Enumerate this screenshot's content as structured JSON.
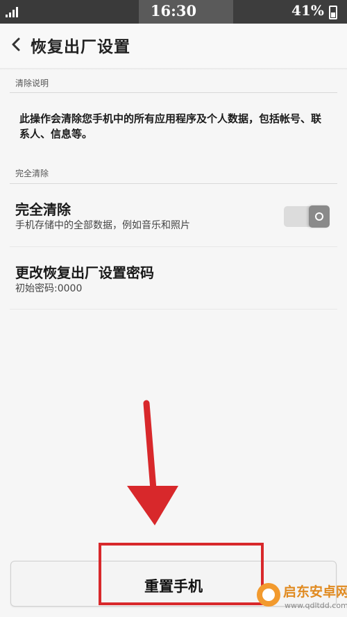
{
  "status_bar": {
    "time": "16:30",
    "battery_percent": "41%",
    "battery_level": 0.41,
    "signal_icon": "signal-bars-icon",
    "battery_icon": "battery-icon"
  },
  "header": {
    "back_icon": "chevron-left-icon",
    "title": "恢复出厂设置"
  },
  "sections": {
    "clear_info": {
      "header": "清除说明",
      "description": "此操作会清除您手机中的所有应用程序及个人数据，包括帐号、联系人、信息等。"
    },
    "full_clear": {
      "header": "完全清除",
      "title": "完全清除",
      "subtitle": "手机存储中的全部数据，例如音乐和照片",
      "toggle_on": false
    },
    "password": {
      "title": "更改恢复出厂设置密码",
      "subtitle": "初始密码:0000"
    }
  },
  "action": {
    "reset_label": "重置手机"
  },
  "annotation": {
    "color": "#d8282b"
  },
  "watermark": {
    "title": "启东安卓网",
    "url": "www.qdltdd.com"
  }
}
